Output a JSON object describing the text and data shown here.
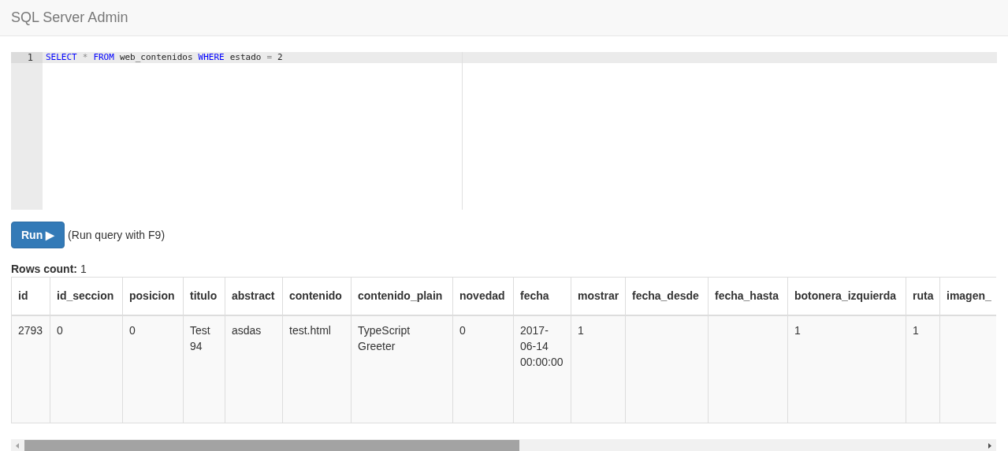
{
  "navbar": {
    "title": "SQL Server Admin"
  },
  "editor": {
    "lines": [
      {
        "number": "1",
        "tokens": [
          {
            "kind": "keyword",
            "text": "SELECT"
          },
          {
            "kind": "operator",
            "text": "*"
          },
          {
            "kind": "keyword",
            "text": "FROM"
          },
          {
            "kind": "plain",
            "text": "web_contenidos"
          },
          {
            "kind": "keyword",
            "text": "WHERE"
          },
          {
            "kind": "plain",
            "text": "estado"
          },
          {
            "kind": "operator",
            "text": "="
          },
          {
            "kind": "plain",
            "text": "2"
          }
        ]
      }
    ]
  },
  "run_button": {
    "label": "Run",
    "icon": "▶"
  },
  "hint": "(Run query with F9)",
  "rows_count": {
    "label": "Rows count:",
    "value": "1"
  },
  "table": {
    "columns": [
      "id",
      "id_seccion",
      "posicion",
      "titulo",
      "abstract",
      "contenido",
      "contenido_plain",
      "novedad",
      "fecha",
      "mostrar",
      "fecha_desde",
      "fecha_hasta",
      "botonera_izquierda",
      "ruta",
      "imagen_"
    ],
    "rows": [
      [
        "2793",
        "0",
        "0",
        "Test 94",
        "asdas",
        "test.html",
        "TypeScript Greeter",
        "0",
        "2017-06-14 00:00:00",
        "1",
        "",
        "",
        "1",
        "1",
        ""
      ]
    ]
  }
}
